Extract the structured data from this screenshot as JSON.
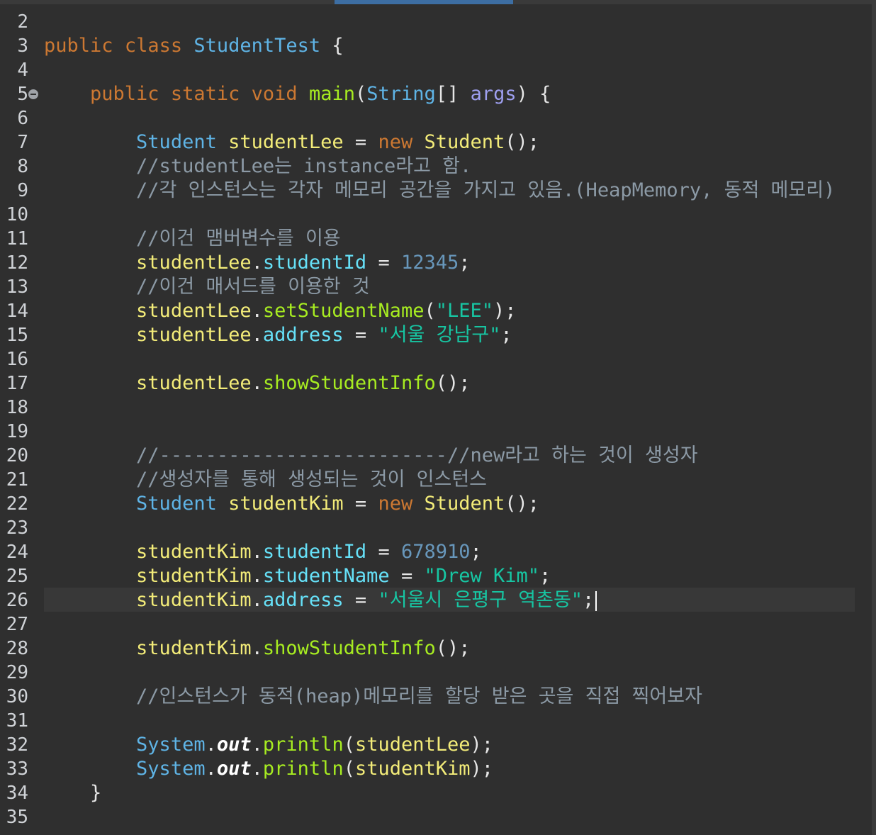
{
  "editor": {
    "current_line": 26,
    "lines": [
      {
        "n": "2",
        "tokens": []
      },
      {
        "n": "3",
        "tokens": [
          [
            "kw",
            "public"
          ],
          [
            "pl",
            " "
          ],
          [
            "kw",
            "class"
          ],
          [
            "pl",
            " "
          ],
          [
            "typ",
            "StudentTest"
          ],
          [
            "pl",
            " {"
          ]
        ]
      },
      {
        "n": "4",
        "tokens": []
      },
      {
        "n": "5",
        "fold": true,
        "tokens": [
          [
            "pl",
            "    "
          ],
          [
            "kw",
            "public"
          ],
          [
            "pl",
            " "
          ],
          [
            "kw",
            "static"
          ],
          [
            "pl",
            " "
          ],
          [
            "kw",
            "void"
          ],
          [
            "pl",
            " "
          ],
          [
            "mth",
            "main"
          ],
          [
            "pl",
            "("
          ],
          [
            "typ",
            "String"
          ],
          [
            "pl",
            "[] "
          ],
          [
            "par",
            "args"
          ],
          [
            "pl",
            ") {"
          ]
        ]
      },
      {
        "n": "6",
        "tokens": []
      },
      {
        "n": "7",
        "tokens": [
          [
            "pl",
            "        "
          ],
          [
            "typ",
            "Student"
          ],
          [
            "pl",
            " "
          ],
          [
            "var",
            "studentLee"
          ],
          [
            "pl",
            " = "
          ],
          [
            "kw",
            "new"
          ],
          [
            "pl",
            " "
          ],
          [
            "var",
            "Student"
          ],
          [
            "pl",
            "();"
          ]
        ]
      },
      {
        "n": "8",
        "tokens": [
          [
            "pl",
            "        "
          ],
          [
            "cmt",
            "//studentLee는 instance라고 함."
          ]
        ]
      },
      {
        "n": "9",
        "tokens": [
          [
            "pl",
            "        "
          ],
          [
            "cmt",
            "//각 인스턴스는 각자 메모리 공간을 가지고 있음.(HeapMemory, 동적 메모리)"
          ]
        ]
      },
      {
        "n": "10",
        "tokens": []
      },
      {
        "n": "11",
        "tokens": [
          [
            "pl",
            "        "
          ],
          [
            "cmt",
            "//이건 맴버변수를 이용"
          ]
        ]
      },
      {
        "n": "12",
        "tokens": [
          [
            "pl",
            "        "
          ],
          [
            "var",
            "studentLee"
          ],
          [
            "pl",
            "."
          ],
          [
            "fld",
            "studentId"
          ],
          [
            "pl",
            " = "
          ],
          [
            "num",
            "12345"
          ],
          [
            "pl",
            ";"
          ]
        ]
      },
      {
        "n": "13",
        "tokens": [
          [
            "pl",
            "        "
          ],
          [
            "cmt",
            "//이건 매서드를 이용한 것"
          ]
        ]
      },
      {
        "n": "14",
        "tokens": [
          [
            "pl",
            "        "
          ],
          [
            "var",
            "studentLee"
          ],
          [
            "pl",
            "."
          ],
          [
            "mth",
            "setStudentName"
          ],
          [
            "pl",
            "("
          ],
          [
            "str",
            "\"LEE\""
          ],
          [
            "pl",
            ");"
          ]
        ]
      },
      {
        "n": "15",
        "tokens": [
          [
            "pl",
            "        "
          ],
          [
            "var",
            "studentLee"
          ],
          [
            "pl",
            "."
          ],
          [
            "fld",
            "address"
          ],
          [
            "pl",
            " = "
          ],
          [
            "str",
            "\"서울 강남구\""
          ],
          [
            "pl",
            ";"
          ]
        ]
      },
      {
        "n": "16",
        "tokens": []
      },
      {
        "n": "17",
        "tokens": [
          [
            "pl",
            "        "
          ],
          [
            "var",
            "studentLee"
          ],
          [
            "pl",
            "."
          ],
          [
            "mth",
            "showStudentInfo"
          ],
          [
            "pl",
            "();"
          ]
        ]
      },
      {
        "n": "18",
        "tokens": []
      },
      {
        "n": "19",
        "tokens": []
      },
      {
        "n": "20",
        "tokens": [
          [
            "pl",
            "        "
          ],
          [
            "cmt",
            "//-------------------------//new라고 하는 것이 생성자"
          ]
        ]
      },
      {
        "n": "21",
        "tokens": [
          [
            "pl",
            "        "
          ],
          [
            "cmt",
            "//생성자를 통해 생성되는 것이 인스턴스"
          ]
        ]
      },
      {
        "n": "22",
        "tokens": [
          [
            "pl",
            "        "
          ],
          [
            "typ",
            "Student"
          ],
          [
            "pl",
            " "
          ],
          [
            "var",
            "studentKim"
          ],
          [
            "pl",
            " = "
          ],
          [
            "kw",
            "new"
          ],
          [
            "pl",
            " "
          ],
          [
            "var",
            "Student"
          ],
          [
            "pl",
            "();"
          ]
        ]
      },
      {
        "n": "23",
        "tokens": []
      },
      {
        "n": "24",
        "tokens": [
          [
            "pl",
            "        "
          ],
          [
            "var",
            "studentKim"
          ],
          [
            "pl",
            "."
          ],
          [
            "fld",
            "studentId"
          ],
          [
            "pl",
            " = "
          ],
          [
            "num",
            "678910"
          ],
          [
            "pl",
            ";"
          ]
        ]
      },
      {
        "n": "25",
        "tokens": [
          [
            "pl",
            "        "
          ],
          [
            "var",
            "studentKim"
          ],
          [
            "pl",
            "."
          ],
          [
            "fld",
            "studentName"
          ],
          [
            "pl",
            " = "
          ],
          [
            "str",
            "\"Drew Kim\""
          ],
          [
            "pl",
            ";"
          ]
        ]
      },
      {
        "n": "26",
        "caret": true,
        "tokens": [
          [
            "pl",
            "        "
          ],
          [
            "var",
            "studentKim"
          ],
          [
            "pl",
            "."
          ],
          [
            "fld",
            "address"
          ],
          [
            "pl",
            " = "
          ],
          [
            "str",
            "\"서울시 은평구 역촌동\""
          ],
          [
            "pl",
            ";"
          ]
        ]
      },
      {
        "n": "27",
        "tokens": []
      },
      {
        "n": "28",
        "tokens": [
          [
            "pl",
            "        "
          ],
          [
            "var",
            "studentKim"
          ],
          [
            "pl",
            "."
          ],
          [
            "mth",
            "showStudentInfo"
          ],
          [
            "pl",
            "();"
          ]
        ]
      },
      {
        "n": "29",
        "tokens": []
      },
      {
        "n": "30",
        "tokens": [
          [
            "pl",
            "        "
          ],
          [
            "cmt",
            "//인스턴스가 동적(heap)메모리를 할당 받은 곳을 직접 찍어보자"
          ]
        ]
      },
      {
        "n": "31",
        "tokens": []
      },
      {
        "n": "32",
        "tokens": [
          [
            "pl",
            "        "
          ],
          [
            "typ",
            "System"
          ],
          [
            "pl",
            "."
          ],
          [
            "stc",
            "out"
          ],
          [
            "pl",
            "."
          ],
          [
            "mth",
            "println"
          ],
          [
            "pl",
            "("
          ],
          [
            "var",
            "studentLee"
          ],
          [
            "pl",
            ");"
          ]
        ]
      },
      {
        "n": "33",
        "tokens": [
          [
            "pl",
            "        "
          ],
          [
            "typ",
            "System"
          ],
          [
            "pl",
            "."
          ],
          [
            "stc",
            "out"
          ],
          [
            "pl",
            "."
          ],
          [
            "mth",
            "println"
          ],
          [
            "pl",
            "("
          ],
          [
            "var",
            "studentKim"
          ],
          [
            "pl",
            ");"
          ]
        ]
      },
      {
        "n": "34",
        "tokens": [
          [
            "pl",
            "    }"
          ]
        ]
      },
      {
        "n": "35",
        "tokens": []
      }
    ]
  },
  "colors": {
    "background": "#2f2f2f",
    "keyword": "#cc7832",
    "type": "#5fb4e6",
    "variable": "#f3ec79",
    "field": "#66e1f8",
    "method": "#a7ec21",
    "string": "#17c6a3",
    "number": "#6897bb",
    "comment": "#8c9aa6",
    "selection_accent": "#3d6ea3"
  }
}
